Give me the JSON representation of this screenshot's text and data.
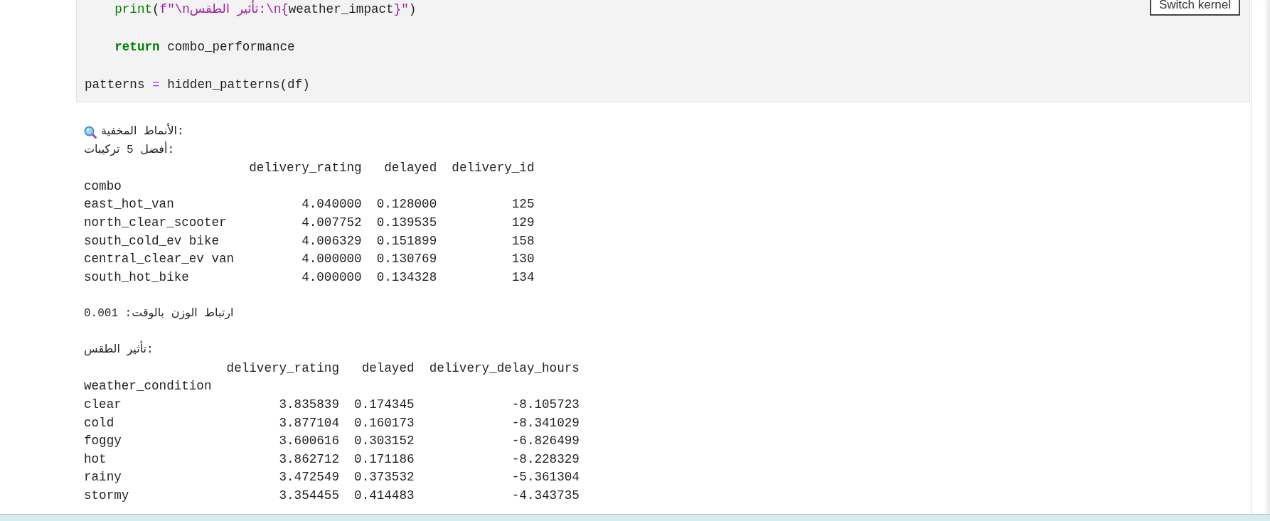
{
  "code_cell": {
    "blocks": [
      [
        {
          "tokens": [
            {
              "kind": "builtin",
              "text": "    print"
            },
            {
              "kind": "plain",
              "text": "("
            },
            {
              "kind": "string",
              "text": "f\"\\nتأثير الطقس:\\n{"
            },
            {
              "kind": "plain",
              "text": "weather_impact"
            },
            {
              "kind": "string",
              "text": "}\""
            },
            {
              "kind": "plain",
              "text": ")"
            }
          ]
        }
      ],
      [
        {
          "tokens": [
            {
              "kind": "keyword",
              "text": "    return"
            },
            {
              "kind": "plain",
              "text": " combo_performance"
            }
          ]
        }
      ],
      [
        {
          "tokens": [
            {
              "kind": "plain",
              "text": "patterns "
            },
            {
              "kind": "operator",
              "text": "="
            },
            {
              "kind": "plain",
              "text": " hidden_patterns(df)"
            }
          ]
        }
      ]
    ]
  },
  "kernel_button": {
    "label": "Switch kernel"
  },
  "output": {
    "blocks": [
      [
        {
          "kind": "heading",
          "text": "الأنماط المخفية:"
        },
        {
          "kind": "text",
          "text": "أفضل 5 تركيبات:"
        },
        {
          "kind": "table",
          "index_name": "combo",
          "columns": [
            "delivery_rating",
            "delayed",
            "delivery_id"
          ],
          "rows": [
            {
              "index": "east_hot_van",
              "values": [
                "4.040000",
                "0.128000",
                "125"
              ]
            },
            {
              "index": "north_clear_scooter",
              "values": [
                "4.007752",
                "0.139535",
                "129"
              ]
            },
            {
              "index": "south_cold_ev bike",
              "values": [
                "4.006329",
                "0.151899",
                "158"
              ]
            },
            {
              "index": "central_clear_ev van",
              "values": [
                "4.000000",
                "0.130769",
                "130"
              ]
            },
            {
              "index": "south_hot_bike",
              "values": [
                "4.000000",
                "0.134328",
                "134"
              ]
            }
          ]
        }
      ],
      [
        {
          "kind": "text",
          "text": "ارتباط الوزن بالوقت: 0.001"
        }
      ],
      [
        {
          "kind": "text",
          "text": "تأثير الطقس:"
        },
        {
          "kind": "table",
          "index_name": "weather_condition",
          "columns": [
            "delivery_rating",
            "delayed",
            "delivery_delay_hours"
          ],
          "rows": [
            {
              "index": "clear",
              "values": [
                "3.835839",
                "0.174345",
                "-8.105723"
              ]
            },
            {
              "index": "cold",
              "values": [
                "3.877104",
                "0.160173",
                "-8.341029"
              ]
            },
            {
              "index": "foggy",
              "values": [
                "3.600616",
                "0.303152",
                "-6.826499"
              ]
            },
            {
              "index": "hot",
              "values": [
                "3.862712",
                "0.171186",
                "-8.228329"
              ]
            },
            {
              "index": "rainy",
              "values": [
                "3.472549",
                "0.373532",
                "-5.361304"
              ]
            },
            {
              "index": "stormy",
              "values": [
                "3.354455",
                "0.414483",
                "-4.343735"
              ]
            }
          ]
        }
      ]
    ]
  }
}
